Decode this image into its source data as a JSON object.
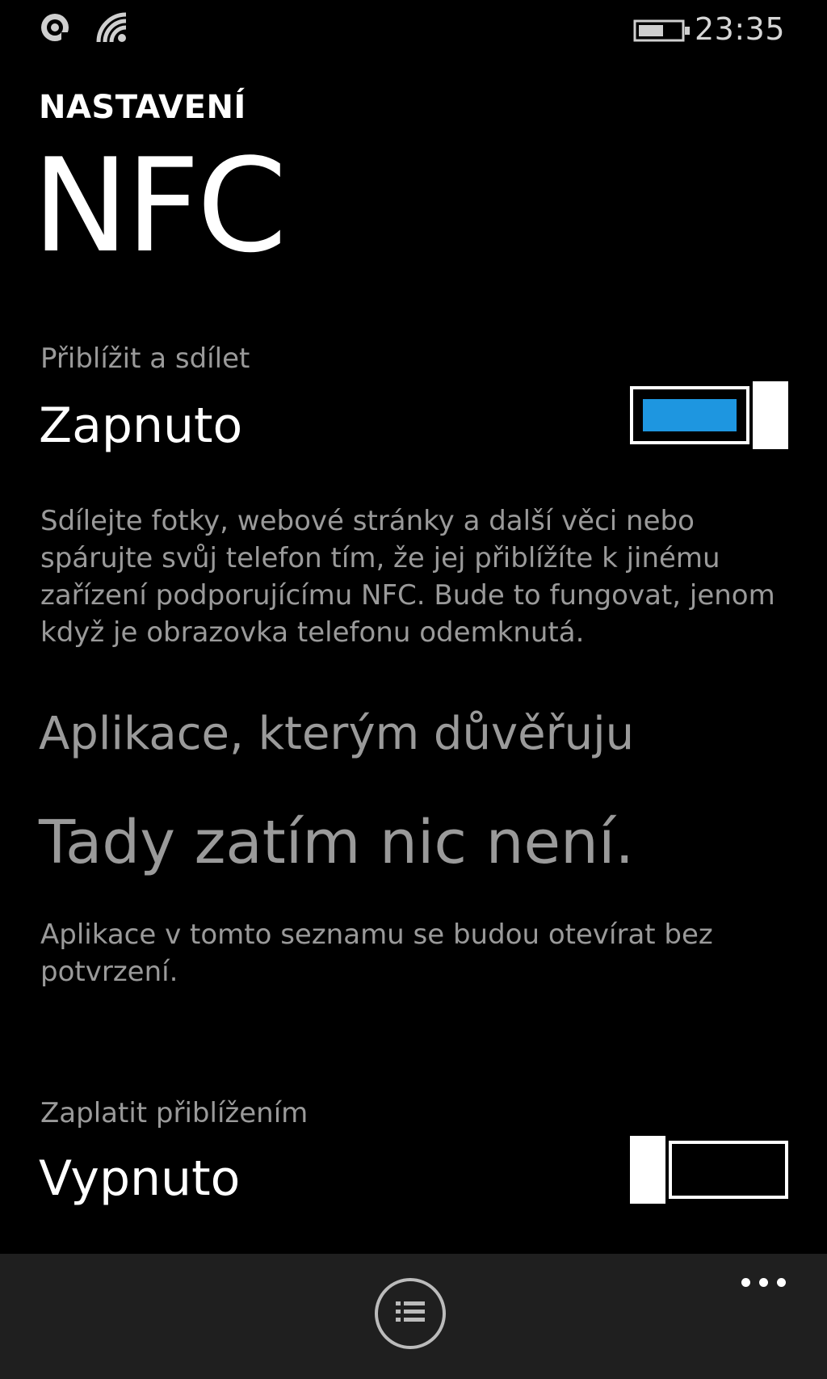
{
  "status_bar": {
    "time": "23:35",
    "icons": [
      "notification-icon",
      "wifi-icon",
      "battery-icon"
    ]
  },
  "header": {
    "app_title": "NASTAVENÍ",
    "page_title": "NFC"
  },
  "tap_to_share": {
    "label": "Přiblížit a sdílet",
    "value": "Zapnuto",
    "enabled": true,
    "description": "Sdílejte fotky, webové stránky a další věci nebo spárujte svůj telefon tím, že jej přiblížíte k jinému zařízení podporujícímu NFC. Bude to fungovat, jenom když je obrazovka telefonu odemknutá."
  },
  "trusted_apps": {
    "title": "Aplikace, kterým důvěřuju",
    "empty_message": "Tady zatím nic není.",
    "description": "Aplikace v tomto seznamu se budou otevírat bez potvrzení."
  },
  "tap_to_pay": {
    "label": "Zaplatit přiblížením",
    "value": "Vypnuto",
    "enabled": false
  },
  "app_bar": {
    "button_icon": "list-icon",
    "more_icon": "more-icon"
  },
  "colors": {
    "accent": "#1e96e0",
    "background": "#000000",
    "secondary_text": "#9a9a9a",
    "app_bar": "#1f1f1f"
  }
}
